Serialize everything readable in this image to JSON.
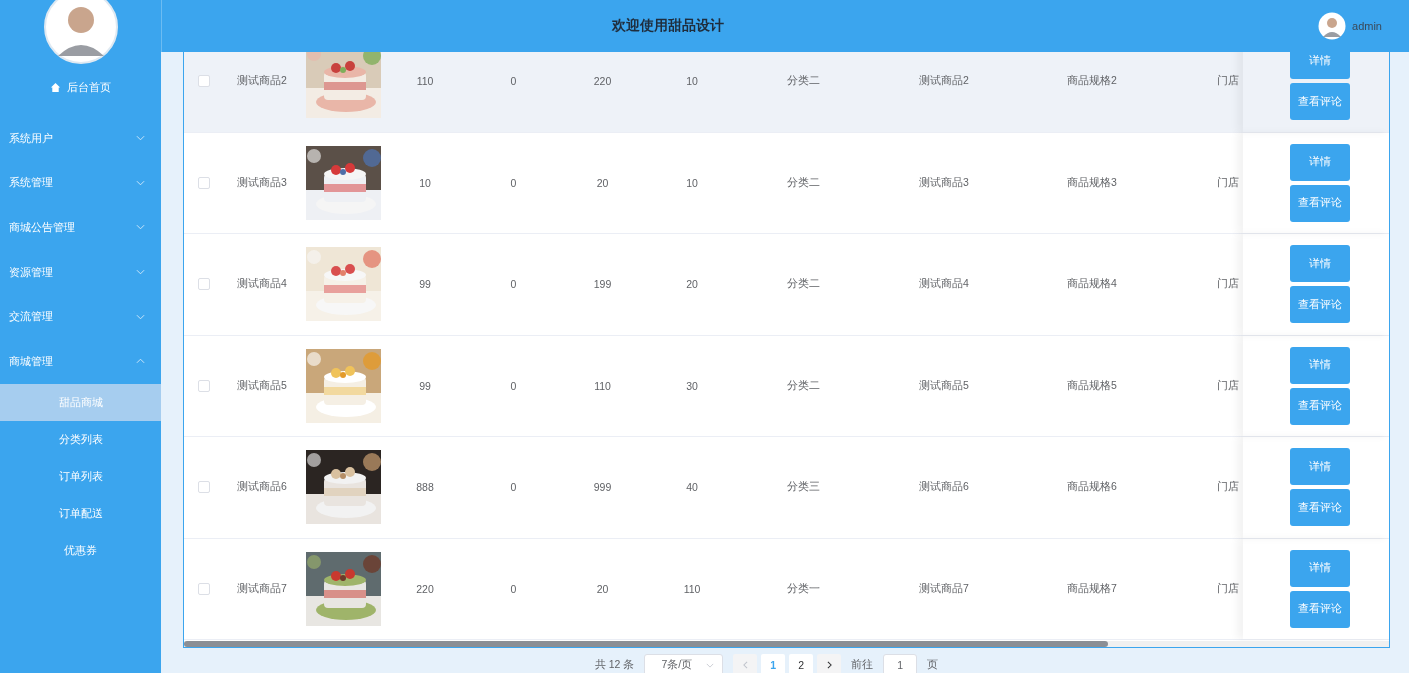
{
  "header": {
    "title": "欢迎使用甜品设计",
    "user": "admin"
  },
  "sidebar": {
    "home": "后台首页",
    "menus": [
      {
        "label": "系统用户",
        "expanded": false
      },
      {
        "label": "系统管理",
        "expanded": false
      },
      {
        "label": "商城公告管理",
        "expanded": false
      },
      {
        "label": "资源管理",
        "expanded": false
      },
      {
        "label": "交流管理",
        "expanded": false
      },
      {
        "label": "商城管理",
        "expanded": true,
        "children": [
          {
            "label": "甜品商城",
            "selected": true
          },
          {
            "label": "分类列表",
            "selected": false
          },
          {
            "label": "订单列表",
            "selected": false
          },
          {
            "label": "订单配送",
            "selected": false
          },
          {
            "label": "优惠券",
            "selected": false
          }
        ]
      }
    ]
  },
  "table": {
    "rows": [
      {
        "checked": false,
        "hovered": true,
        "name": "测试商品2",
        "kind": "picture",
        "column_4": "110",
        "column_5": "0",
        "column_6": "220",
        "column_7": "10",
        "category": "分类二",
        "column_9": "测试商品2",
        "spec": "商品规格2",
        "store": "门店",
        "actions": [
          "详情",
          "查看评论"
        ]
      },
      {
        "checked": false,
        "hovered": false,
        "name": "测试商品3",
        "kind": "picture",
        "column_4": "10",
        "column_5": "0",
        "column_6": "20",
        "column_7": "10",
        "category": "分类二",
        "column_9": "测试商品3",
        "spec": "商品规格3",
        "store": "门店",
        "actions": [
          "详情",
          "查看评论"
        ]
      },
      {
        "checked": false,
        "hovered": false,
        "name": "测试商品4",
        "kind": "picture",
        "column_4": "99",
        "column_5": "0",
        "column_6": "199",
        "column_7": "20",
        "category": "分类二",
        "column_9": "测试商品4",
        "spec": "商品规格4",
        "store": "门店",
        "actions": [
          "详情",
          "查看评论"
        ]
      },
      {
        "checked": false,
        "hovered": false,
        "name": "测试商品5",
        "kind": "picture",
        "column_4": "99",
        "column_5": "0",
        "column_6": "110",
        "column_7": "30",
        "category": "分类二",
        "column_9": "测试商品5",
        "spec": "商品规格5",
        "store": "门店",
        "actions": [
          "详情",
          "查看评论"
        ]
      },
      {
        "checked": false,
        "hovered": false,
        "name": "测试商品6",
        "kind": "picture",
        "column_4": "888",
        "column_5": "0",
        "column_6": "999",
        "column_7": "40",
        "category": "分类三",
        "column_9": "测试商品6",
        "spec": "商品规格6",
        "store": "门店",
        "actions": [
          "详情",
          "查看评论"
        ]
      },
      {
        "checked": false,
        "hovered": false,
        "name": "测试商品7",
        "kind": "picture",
        "column_4": "220",
        "column_5": "0",
        "column_6": "20",
        "column_7": "110",
        "category": "分类一",
        "column_9": "测试商品7",
        "spec": "商品规格7",
        "store": "门店",
        "actions": [
          "详情",
          "查看评论"
        ]
      }
    ]
  },
  "pagination": {
    "total": "共 12 条",
    "page_size": "7条/页",
    "pages": [
      {
        "label": "1",
        "selected": true
      },
      {
        "label": "2",
        "selected": false
      }
    ],
    "goto_label": "前往",
    "goto_value": "1",
    "goto_suffix": "页"
  }
}
